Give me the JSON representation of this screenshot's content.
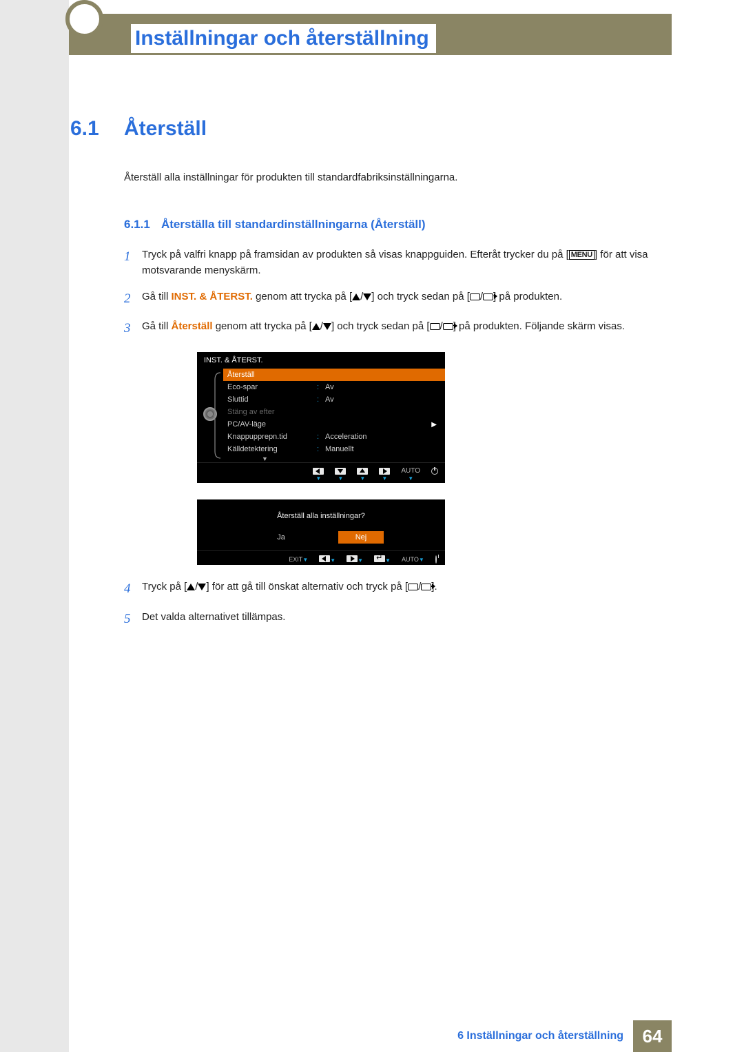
{
  "header": {
    "title": "Inställningar och återställning"
  },
  "section": {
    "num": "6.1",
    "title": "Återställ",
    "intro": "Återställ alla inställningar för produkten till standardfabriksinställningarna."
  },
  "subsection": {
    "num": "6.1.1",
    "title": "Återställa till standardinställningarna (Återställ)"
  },
  "steps": {
    "s1_a": "Tryck på valfri knapp på framsidan av produkten så visas knappguiden. Efteråt trycker du på [",
    "s1_menu": "MENU",
    "s1_b": "] för att visa motsvarande menyskärm.",
    "s2_a": "Gå till ",
    "s2_bold": "INST. & ÅTERST.",
    "s2_b": " genom att trycka på [",
    "s2_c": "] och tryck sedan på [",
    "s2_d": "] på produkten.",
    "s3_a": "Gå till ",
    "s3_bold": "Återställ",
    "s3_b": " genom att trycka på [",
    "s3_c": "] och tryck sedan på [",
    "s3_d": "] på produkten. Följande skärm visas.",
    "s4_a": "Tryck på [",
    "s4_b": "] för att gå till önskat alternativ och tryck på [",
    "s4_c": "].",
    "s5": "Det valda alternativet tillämpas."
  },
  "osd1": {
    "title": "INST. & ÅTERST.",
    "rows": [
      {
        "label": "Återställ",
        "val": "",
        "hl": true
      },
      {
        "label": "Eco-spar",
        "val": "Av"
      },
      {
        "label": "Sluttid",
        "val": "Av"
      },
      {
        "label": "Stäng av efter",
        "val": "",
        "dim": true
      },
      {
        "label": "PC/AV-läge",
        "val": "",
        "chevron": true
      },
      {
        "label": "Knappupprepn.tid",
        "val": "Acceleration"
      },
      {
        "label": "Källdetektering",
        "val": "Manuellt"
      }
    ],
    "nav_auto": "AUTO"
  },
  "osd2": {
    "question": "Återställ alla inställningar?",
    "yes": "Ja",
    "no": "Nej",
    "exit": "EXIT",
    "auto": "AUTO"
  },
  "footer": {
    "text": "6 Inställningar och återställning",
    "page": "64"
  }
}
